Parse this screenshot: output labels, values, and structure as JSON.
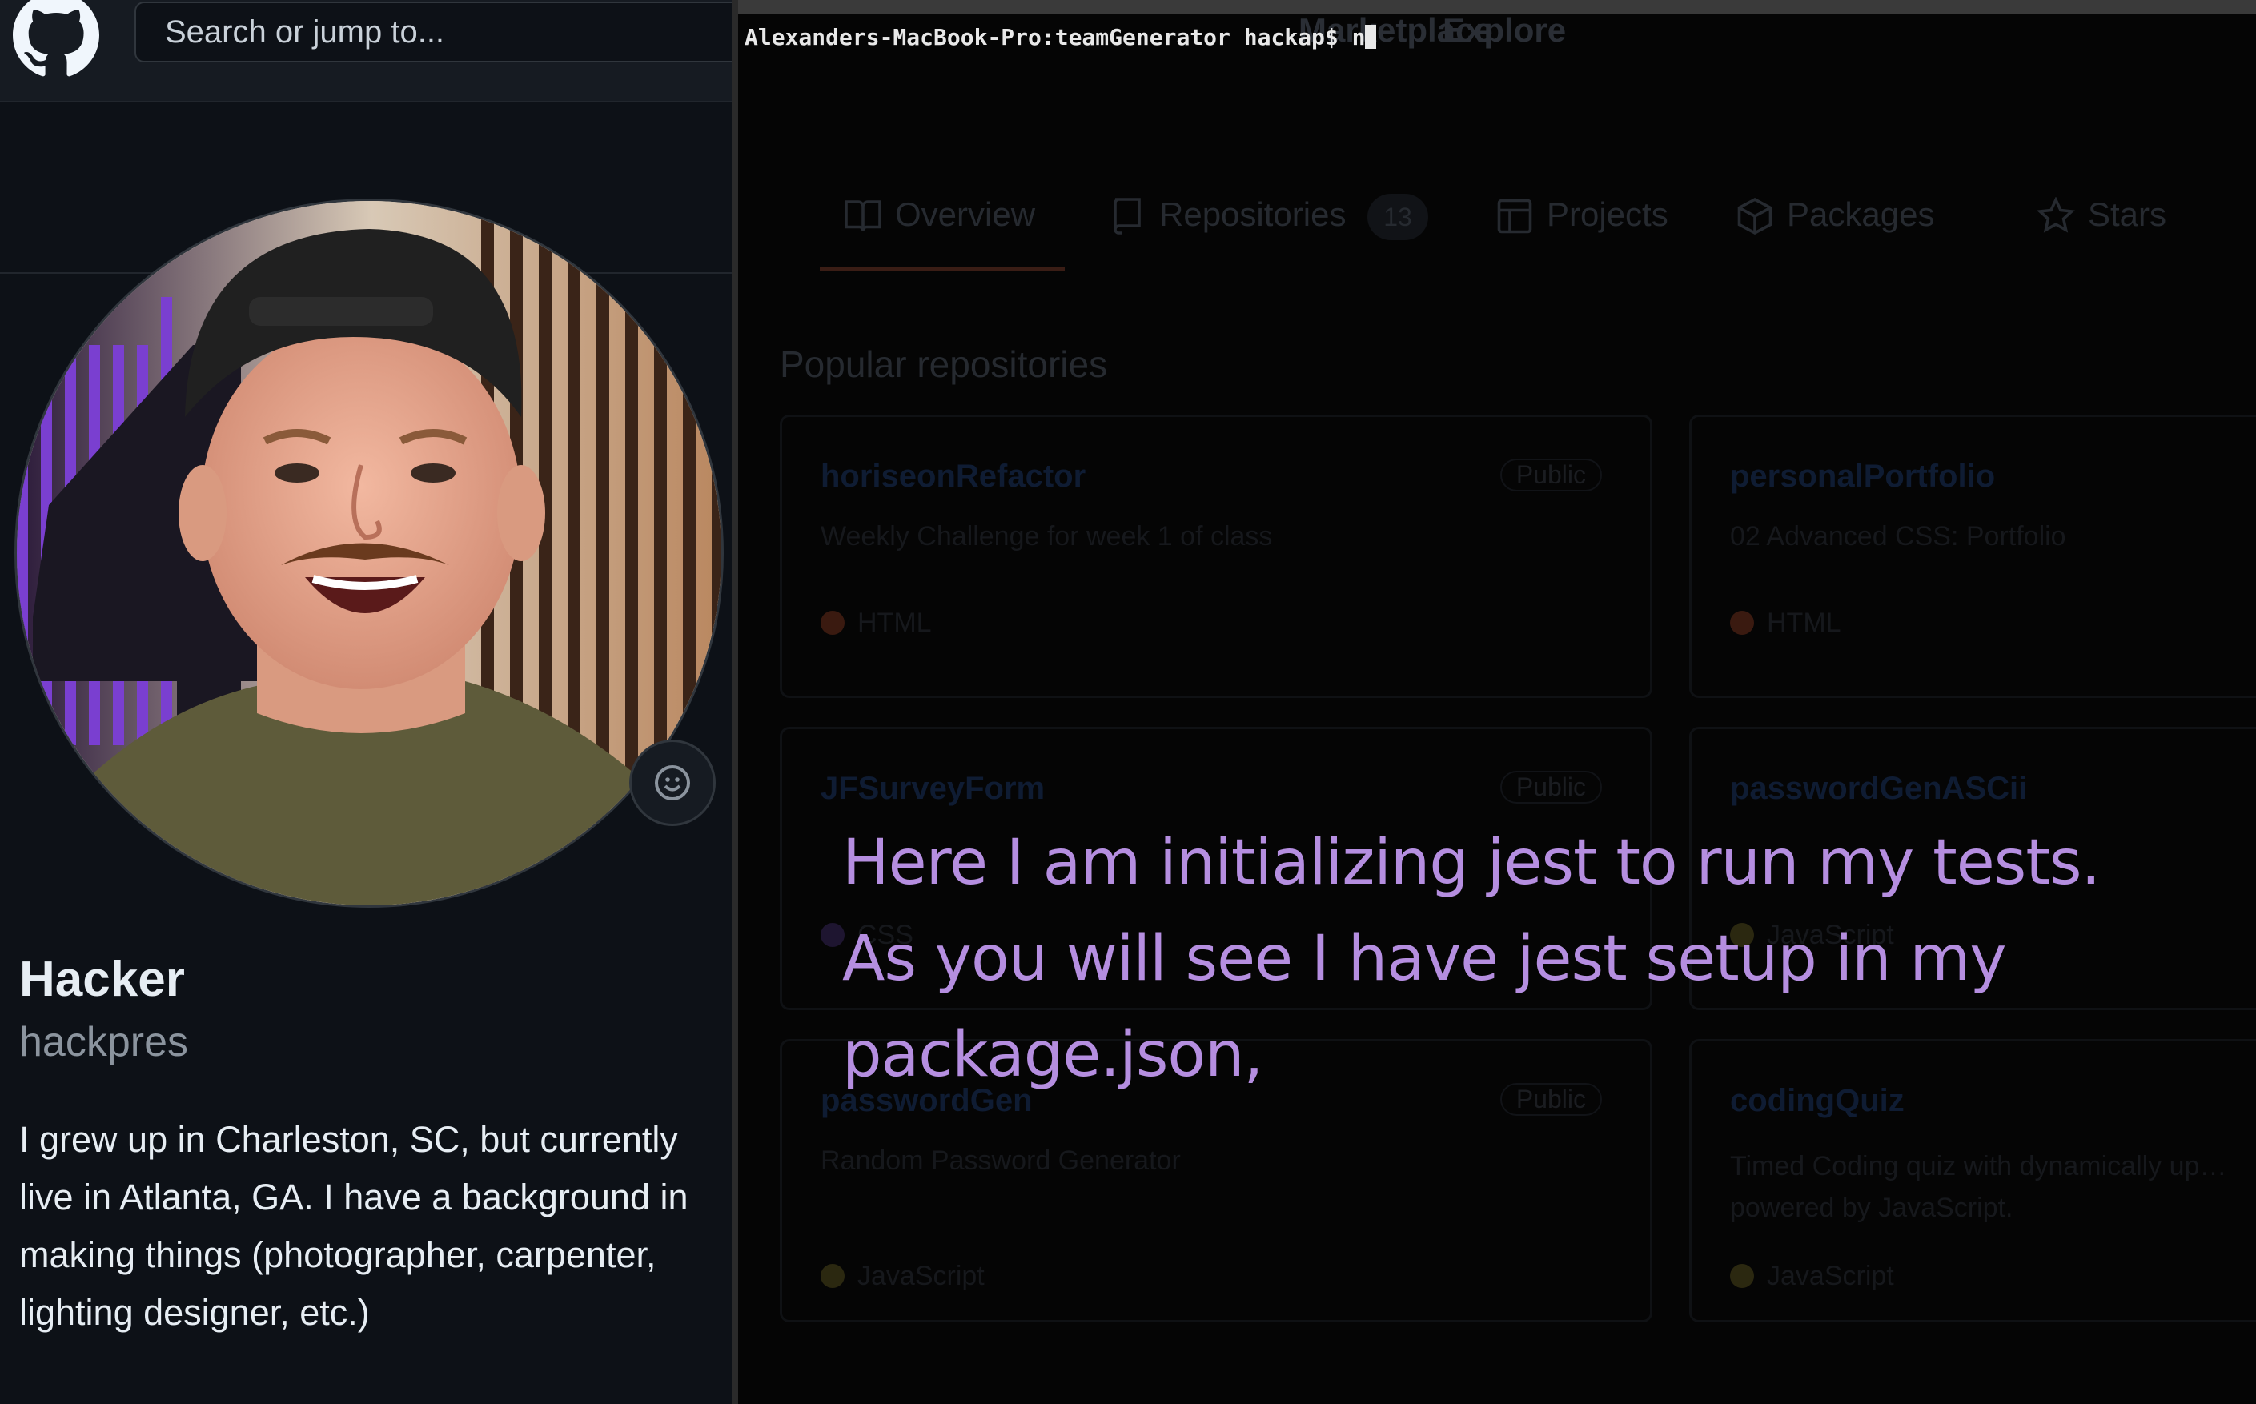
{
  "github": {
    "search_placeholder": "Search or jump to...",
    "nav": {
      "marketplace": "Marketplace",
      "explore": "Explore"
    },
    "profile": {
      "name": "Hacker",
      "login": "hackpres",
      "bio": "I grew up in Charleston, SC, but currently live in Atlanta, GA. I have a background in making things (photographer, carpenter, lighting designer, etc.)"
    },
    "tabs": [
      {
        "label": "Overview",
        "icon": "book-icon"
      },
      {
        "label": "Repositories",
        "icon": "repo-icon",
        "count": "13"
      },
      {
        "label": "Projects",
        "icon": "table-icon"
      },
      {
        "label": "Packages",
        "icon": "package-icon"
      },
      {
        "label": "Stars",
        "icon": "star-icon"
      }
    ],
    "popular_title": "Popular repositories",
    "repos": [
      {
        "name": "horiseonRefactor",
        "visibility": "Public",
        "description": "Weekly Challenge for week 1 of class",
        "language": "HTML",
        "lang_color": "#3a1a10"
      },
      {
        "name": "personalPortfolio",
        "visibility": "",
        "description": "02 Advanced CSS: Portfolio",
        "language": "HTML",
        "lang_color": "#3a1a10"
      },
      {
        "name": "JFSurveyForm",
        "visibility": "Public",
        "description": "",
        "language": "CSS",
        "lang_color": "#1e1530"
      },
      {
        "name": "passwordGenASCii",
        "visibility": "",
        "description": "",
        "language": "JavaScript",
        "lang_color": "#2b2810"
      },
      {
        "name": "passwordGen",
        "visibility": "Public",
        "description": "Random Password Generator",
        "language": "JavaScript",
        "lang_color": "#2b2810"
      },
      {
        "name": "codingQuiz",
        "visibility": "",
        "description": "Timed Coding quiz with dynamically up… powered by JavaScript.",
        "language": "JavaScript",
        "lang_color": "#2b2810"
      }
    ]
  },
  "terminal": {
    "prompt": "Alexanders-MacBook-Pro:teamGenerator hackap$ n"
  },
  "subtitle": {
    "line1": "Here I am initializing jest to run my tests.",
    "line2": "As you will see I have jest setup in my",
    "line3": "package.json,"
  },
  "colors": {
    "subtitle": "#b58ee0",
    "github_bg": "#0d1117",
    "terminal_bg": "#050505"
  }
}
